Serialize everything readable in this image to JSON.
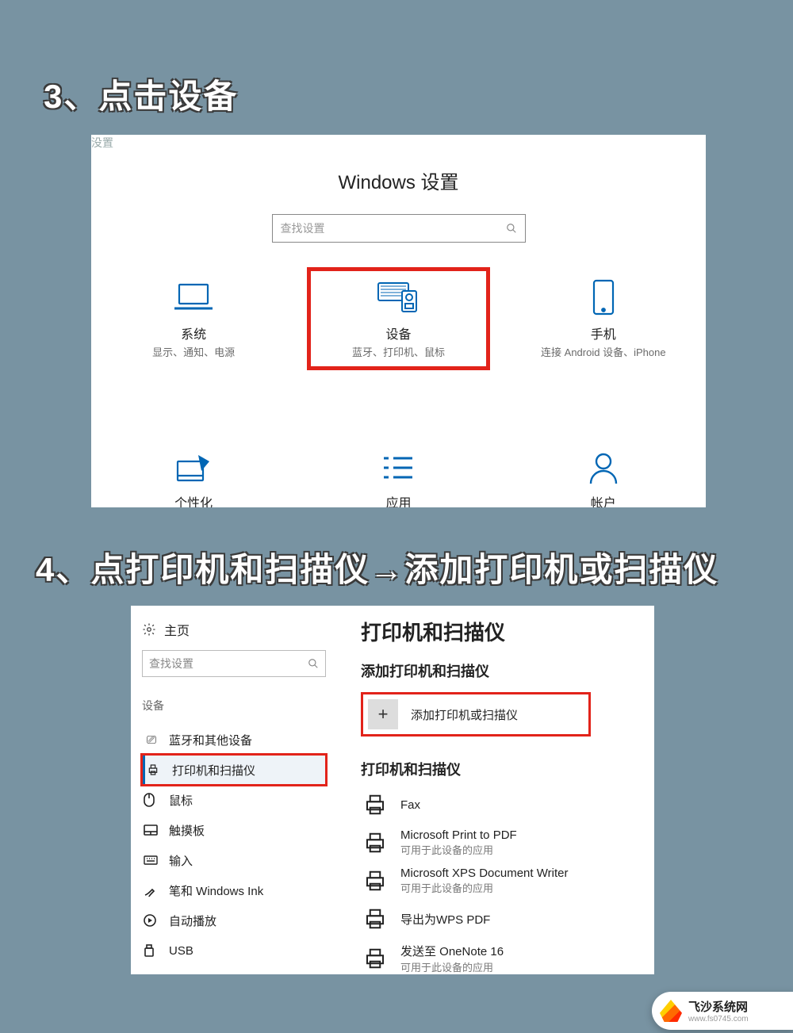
{
  "step3": {
    "title": "3、点击设备"
  },
  "step4": {
    "title": "4、点打印机和扫描仪→添加打印机或扫描仪"
  },
  "panel1": {
    "corner_tag": "没置",
    "window_title": "Windows 设置",
    "search_placeholder": "查找设置",
    "tiles_row1": [
      {
        "id": "system",
        "title": "系统",
        "sub": "显示、通知、电源",
        "highlight": false
      },
      {
        "id": "devices",
        "title": "设备",
        "sub": "蓝牙、打印机、鼠标",
        "highlight": true
      },
      {
        "id": "phone",
        "title": "手机",
        "sub": "连接 Android 设备、iPhone",
        "highlight": false
      }
    ],
    "tiles_row2": [
      {
        "id": "personalization",
        "title": "个性化"
      },
      {
        "id": "apps",
        "title": "应用"
      },
      {
        "id": "accounts",
        "title": "帐户"
      }
    ]
  },
  "panel2": {
    "home_label": "主页",
    "search_placeholder": "查找设置",
    "category_label": "设备",
    "nav": [
      {
        "id": "bluetooth",
        "label": "蓝牙和其他设备",
        "selected": false
      },
      {
        "id": "printers",
        "label": "打印机和扫描仪",
        "selected": true
      },
      {
        "id": "mouse",
        "label": "鼠标",
        "selected": false
      },
      {
        "id": "touchpad",
        "label": "触摸板",
        "selected": false
      },
      {
        "id": "typing",
        "label": "输入",
        "selected": false
      },
      {
        "id": "pen",
        "label": "笔和 Windows Ink",
        "selected": false
      },
      {
        "id": "autoplay",
        "label": "自动播放",
        "selected": false
      },
      {
        "id": "usb",
        "label": "USB",
        "selected": false
      }
    ],
    "page_title": "打印机和扫描仪",
    "section_add_title": "添加打印机和扫描仪",
    "add_button": "添加打印机或扫描仪",
    "section_list_title": "打印机和扫描仪",
    "printers": [
      {
        "main": "Fax",
        "sub": ""
      },
      {
        "main": "Microsoft Print to PDF",
        "sub": "可用于此设备的应用"
      },
      {
        "main": "Microsoft XPS Document Writer",
        "sub": "可用于此设备的应用"
      },
      {
        "main": "导出为WPS PDF",
        "sub": ""
      },
      {
        "main": "发送至 OneNote 16",
        "sub": "可用于此设备的应用"
      }
    ]
  },
  "watermark": {
    "line1": "飞沙系统网",
    "line2": "www.fs0745.com"
  }
}
